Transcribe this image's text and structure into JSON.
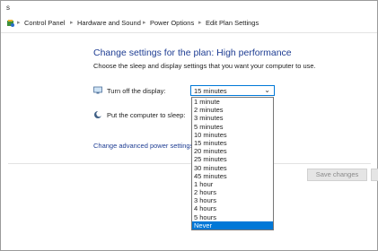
{
  "window": {
    "title_glyph": "s"
  },
  "breadcrumb": {
    "items": [
      "Control Panel",
      "Hardware and Sound",
      "Power Options",
      "Edit Plan Settings"
    ],
    "separator": "▸"
  },
  "main": {
    "heading": "Change settings for the plan: High performance",
    "subtext": "Choose the sleep and display settings that you want your computer to use.",
    "display_label": "Turn off the display:",
    "sleep_label": "Put the computer to sleep:",
    "display_value": "15 minutes",
    "advanced_link": "Change advanced power settings"
  },
  "dropdown": {
    "options": [
      "1 minute",
      "2 minutes",
      "3 minutes",
      "5 minutes",
      "10 minutes",
      "15 minutes",
      "20 minutes",
      "25 minutes",
      "30 minutes",
      "45 minutes",
      "1 hour",
      "2 hours",
      "3 hours",
      "4 hours",
      "5 hours",
      "Never"
    ],
    "highlighted": "Never"
  },
  "footer": {
    "save_label": "Save changes"
  },
  "colors": {
    "accent": "#0078d7",
    "link": "#1e3d93"
  }
}
